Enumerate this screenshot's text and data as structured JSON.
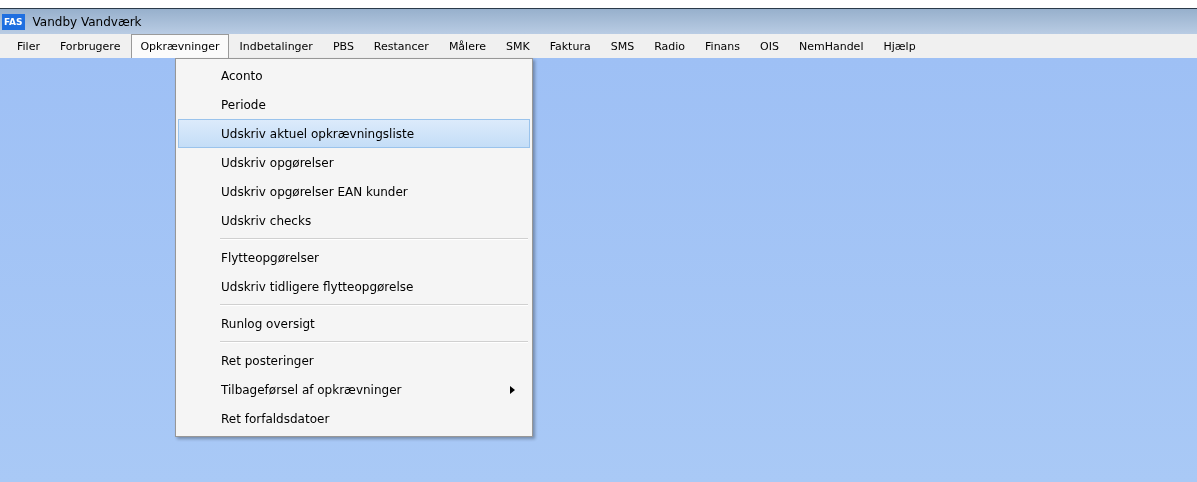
{
  "window": {
    "title": "Vandby Vandværk",
    "logo": "FAS"
  },
  "menu_bar": [
    {
      "label": "Filer",
      "selected": false
    },
    {
      "label": "Forbrugere",
      "selected": false
    },
    {
      "label": "Opkrævninger",
      "selected": true
    },
    {
      "label": "Indbetalinger",
      "selected": false
    },
    {
      "label": "PBS",
      "selected": false
    },
    {
      "label": "Restancer",
      "selected": false
    },
    {
      "label": "Målere",
      "selected": false
    },
    {
      "label": "SMK",
      "selected": false
    },
    {
      "label": "Faktura",
      "selected": false
    },
    {
      "label": "SMS",
      "selected": false
    },
    {
      "label": "Radio",
      "selected": false
    },
    {
      "label": "Finans",
      "selected": false
    },
    {
      "label": "OIS",
      "selected": false
    },
    {
      "label": "NemHandel",
      "selected": false
    },
    {
      "label": "Hjælp",
      "selected": false
    }
  ],
  "dropdown": [
    {
      "kind": "item",
      "label": "Aconto",
      "selected": false,
      "submenu": false
    },
    {
      "kind": "item",
      "label": "Periode",
      "selected": false,
      "submenu": false
    },
    {
      "kind": "item",
      "label": "Udskriv aktuel opkrævningsliste",
      "selected": true,
      "submenu": false
    },
    {
      "kind": "item",
      "label": "Udskriv opgørelser",
      "selected": false,
      "submenu": false
    },
    {
      "kind": "item",
      "label": "Udskriv opgørelser EAN kunder",
      "selected": false,
      "submenu": false
    },
    {
      "kind": "item",
      "label": "Udskriv checks",
      "selected": false,
      "submenu": false
    },
    {
      "kind": "separator"
    },
    {
      "kind": "item",
      "label": "Flytteopgørelser",
      "selected": false,
      "submenu": false
    },
    {
      "kind": "item",
      "label": "Udskriv tidligere flytteopgørelse",
      "selected": false,
      "submenu": false
    },
    {
      "kind": "separator"
    },
    {
      "kind": "item",
      "label": "Runlog oversigt",
      "selected": false,
      "submenu": false
    },
    {
      "kind": "separator"
    },
    {
      "kind": "item",
      "label": "Ret posteringer",
      "selected": false,
      "submenu": false
    },
    {
      "kind": "item",
      "label": "Tilbageførsel af opkrævninger",
      "selected": false,
      "submenu": true
    },
    {
      "kind": "item",
      "label": "Ret forfaldsdatoer",
      "selected": false,
      "submenu": false
    }
  ]
}
